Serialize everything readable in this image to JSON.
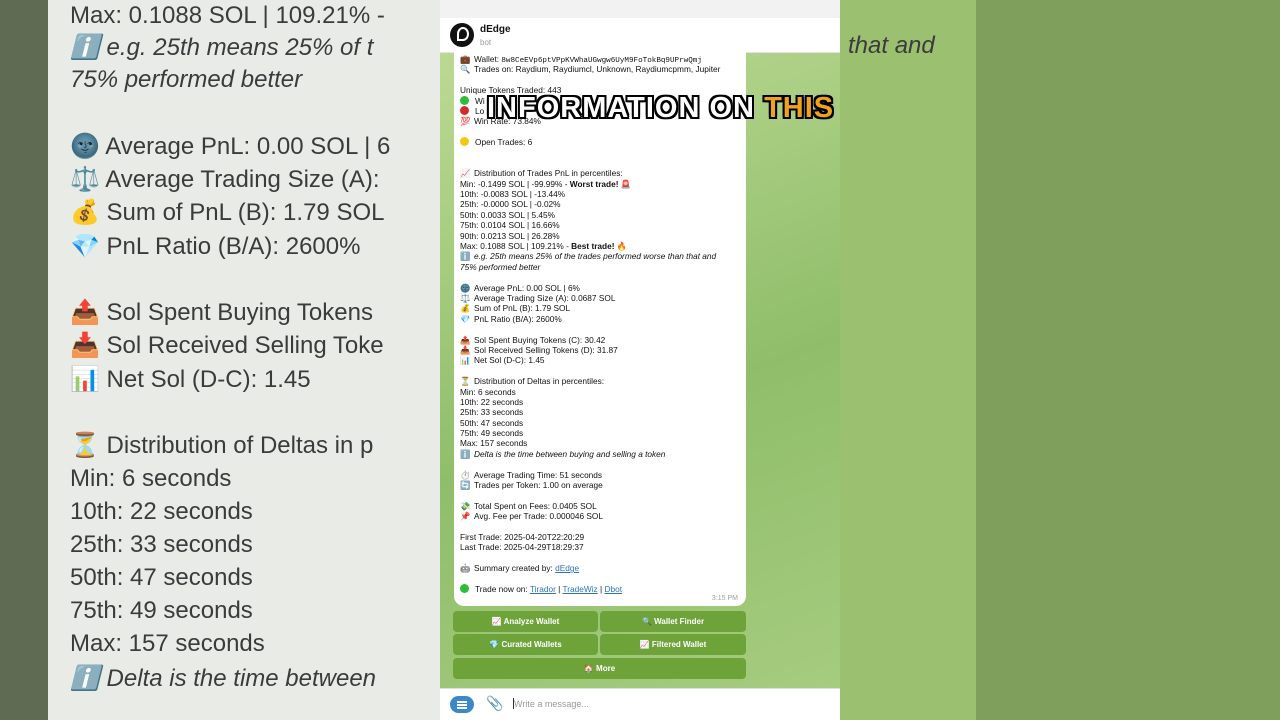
{
  "background_left": {
    "lines": [
      "Max: 0.1088 SOL | 109.21% -",
      "ℹ️ e.g. 25th means 25% of t",
      "75% performed better",
      "🌚 Average PnL: 0.00 SOL | 6",
      "⚖️ Average Trading Size (A):",
      "💰 Sum of PnL (B): 1.79 SOL",
      "💎 PnL Ratio (B/A): 2600%",
      "📤 Sol Spent Buying Tokens",
      "📥 Sol Received Selling Toke",
      "📊 Net Sol (D-C): 1.45",
      "⏳ Distribution of Deltas in p",
      "Min: 6 seconds",
      "10th: 22 seconds",
      "25th: 33 seconds",
      "50th: 47 seconds",
      "75th: 49 seconds",
      "Max: 157 seconds",
      "ℹ️ Delta is the time between"
    ]
  },
  "background_right": {
    "text": "that and"
  },
  "header": {
    "title": "dEdge",
    "subtitle": "bot"
  },
  "overlay": {
    "text_main": "INFORMATION ON ",
    "text_highlight": "THIS"
  },
  "message": {
    "wallet_label": "Wallet:",
    "wallet_address": "8w8CeEVp6ptVPpKVWhaUGwgw6UyM9FoTokBq9UPrwQmj",
    "trades_on": "Trades on: Raydium, Raydiumcl, Unknown, Raydiumcpmm, Jupiter",
    "unique_tokens": "Unique Tokens Traded: 443",
    "wins": "Wi",
    "losses": "Lo",
    "win_rate": "Win Rate: 73.84%",
    "open_trades": "Open Trades: 6",
    "dist_pnl_title": "Distribution of Trades PnL in percentiles:",
    "pnl_min": "Min: -0.1499 SOL | -99.99% - ",
    "pnl_min_tag": "Worst trade!",
    "pnl_10": "10th: -0.0083 SOL | -13.44%",
    "pnl_25": "25th: -0.0000 SOL | -0.02%",
    "pnl_50": "50th: 0.0033 SOL | 5.45%",
    "pnl_75": "75th: 0.0104 SOL | 16.66%",
    "pnl_90": "90th: 0.0213 SOL | 26.28%",
    "pnl_max": "Max: 0.1088 SOL | 109.21% - ",
    "pnl_max_tag": "Best trade!",
    "pnl_note_1": "e.g. 25th means 25% of the trades performed worse than that and",
    "pnl_note_2": "75% performed better",
    "avg_pnl": "Average PnL: 0.00 SOL | 6%",
    "avg_size": "Average Trading Size (A): 0.0687 SOL",
    "sum_pnl": "Sum of PnL (B): 1.79 SOL",
    "pnl_ratio": "PnL Ratio (B/A): 2600%",
    "sol_spent": "Sol Spent Buying Tokens (C): 30.42",
    "sol_received": "Sol Received Selling Tokens (D): 31.87",
    "net_sol": "Net Sol (D-C): 1.45",
    "dist_delta_title": "Distribution of Deltas in percentiles:",
    "d_min": "Min: 6 seconds",
    "d_10": "10th: 22 seconds",
    "d_25": "25th: 33 seconds",
    "d_50": "50th: 47 seconds",
    "d_75": "75th: 49 seconds",
    "d_max": "Max: 157 seconds",
    "delta_note": "Delta is the time between buying and selling a token",
    "avg_time": "Average Trading Time: 51 seconds",
    "trades_per_token": "Trades per Token: 1.00 on average",
    "fees_total": "Total Spent on Fees: 0.0405 SOL",
    "fee_avg": "Avg. Fee per Trade: 0.000046 SOL",
    "first_trade": "First Trade: 2025-04-20T22:20:29",
    "last_trade": "Last Trade: 2025-04-29T18:29:37",
    "summary_label": "Summary created by: ",
    "summary_link": "dEdge",
    "trade_now_label": "Trade now on: ",
    "trade_links": [
      "Tirador",
      "TradeWiz",
      "Dbot"
    ],
    "sep": " | ",
    "time": "3:15 PM"
  },
  "keyboard": {
    "analyze": "📈 Analyze Wallet",
    "finder": "🔍 Wallet Finder",
    "curated": "💎 Curated Wallets",
    "filtered": "📈 Filtered Wallet",
    "more": "🏠 More"
  },
  "composer": {
    "placeholder": "Write a message..."
  },
  "colors": {
    "accent": "#2a73b8",
    "button": "#6ea33a",
    "chat_bg": "#9fc77c",
    "highlight": "#f2a020"
  }
}
